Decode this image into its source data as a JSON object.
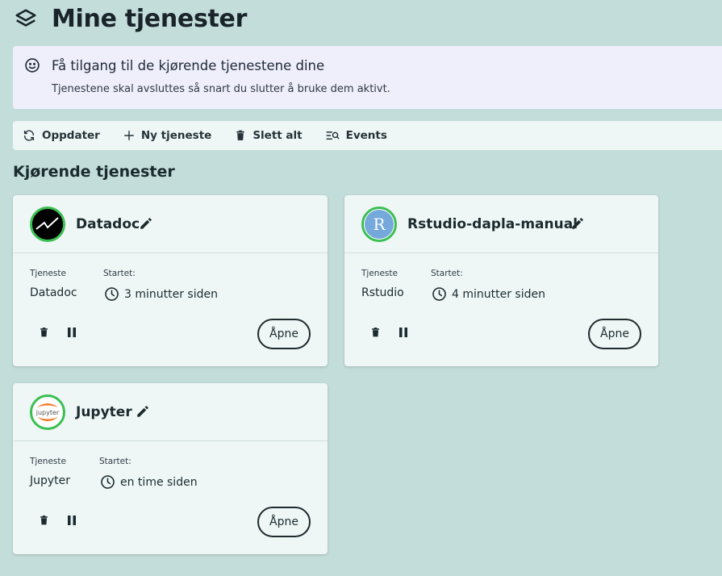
{
  "page": {
    "title": "Mine tjenester"
  },
  "banner": {
    "title": "Få tilgang til de kjørende tjenestene dine",
    "text": "Tjenestene skal avsluttes så snart du slutter å bruke dem aktivt."
  },
  "toolbar": {
    "refresh_label": "Oppdater",
    "new_label": "Ny tjeneste",
    "delete_all_label": "Slett alt",
    "events_label": "Events"
  },
  "section": {
    "title": "Kjørende tjenester"
  },
  "labels": {
    "service": "Tjeneste",
    "started": "Startet:",
    "open": "Åpne"
  },
  "services": [
    {
      "name": "Datadoc",
      "service": "Datadoc",
      "started": "3 minutter siden",
      "logo": "datadoc-logo"
    },
    {
      "name": "Rstudio-dapla-manual",
      "service": "Rstudio",
      "started": "4 minutter siden",
      "logo": "rstudio-logo",
      "logo_text": "R"
    },
    {
      "name": "Jupyter",
      "service": "Jupyter",
      "started": "en time siden",
      "logo": "jupyter-logo",
      "logo_text": "jupyter"
    }
  ],
  "colors": {
    "background": "#c3ddda",
    "banner": "#efeefb",
    "card": "#eef7f6",
    "status_ring": "#3bbf52"
  }
}
